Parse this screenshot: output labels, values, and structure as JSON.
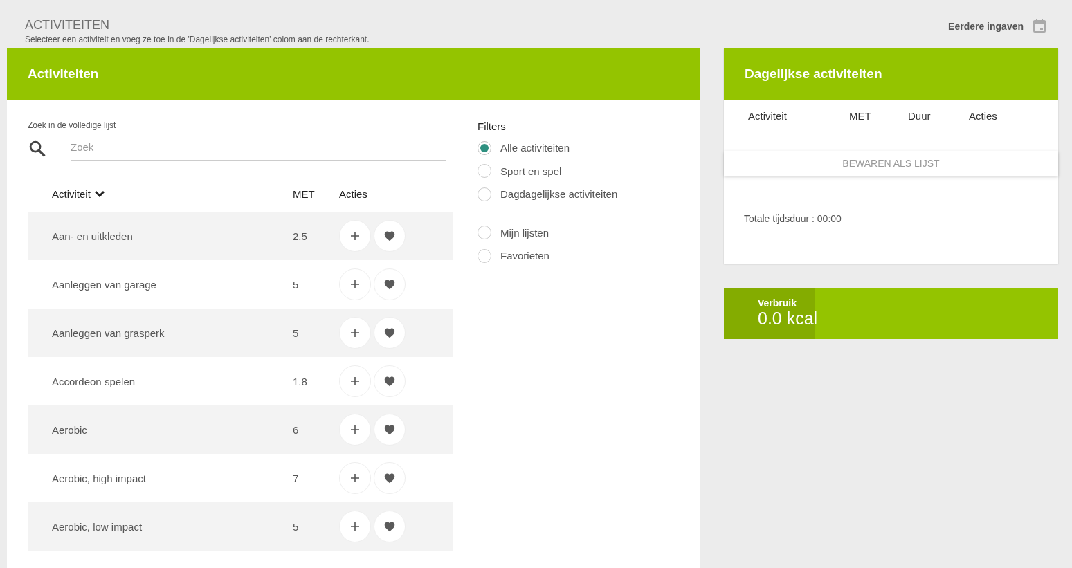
{
  "header": {
    "title": "ACTIVITEITEN",
    "subtitle": "Selecteer een activiteit en voeg ze toe in de 'Dagelijkse activiteiten' colom aan de rechterkant.",
    "history_link": "Eerdere ingaven"
  },
  "activities": {
    "title": "Activiteiten",
    "search_label": "Zoek in de volledige lijst",
    "search": {
      "placeholder": "Zoek"
    },
    "columns": [
      "Activiteit",
      "MET",
      "Acties"
    ],
    "rows": [
      {
        "name": "Aan- en uitkleden",
        "met": "2.5"
      },
      {
        "name": "Aanleggen van garage",
        "met": "5"
      },
      {
        "name": "Aanleggen van grasperk",
        "met": "5"
      },
      {
        "name": "Accordeon spelen",
        "met": "1.8"
      },
      {
        "name": "Aerobic",
        "met": "6"
      },
      {
        "name": "Aerobic, high impact",
        "met": "7"
      },
      {
        "name": "Aerobic, low impact",
        "met": "5"
      }
    ]
  },
  "filters": {
    "title": "Filters",
    "groups": [
      {
        "options": [
          {
            "label": "Alle activiteiten",
            "selected": true
          },
          {
            "label": "Sport en spel",
            "selected": false
          },
          {
            "label": "Dagdagelijkse activiteiten",
            "selected": false
          }
        ]
      },
      {
        "options": [
          {
            "label": "Mijn lijsten",
            "selected": false
          },
          {
            "label": "Favorieten",
            "selected": false
          }
        ]
      }
    ]
  },
  "daily": {
    "title": "Dagelijkse activiteiten",
    "columns": [
      "Activiteit",
      "MET",
      "Duur",
      "Acties"
    ],
    "save_button": "BEWAREN ALS LIJST",
    "total": "Totale tijdsduur : 00:00"
  },
  "consumption": {
    "label": "Verbruik",
    "value": "0.0 kcal"
  }
}
